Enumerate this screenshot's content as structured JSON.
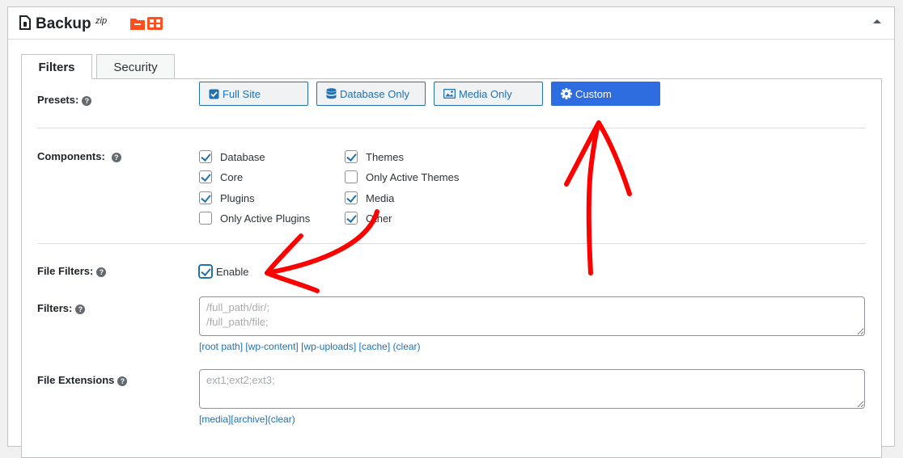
{
  "panel": {
    "title": "Backup",
    "title_sup": "zip",
    "icons": [
      "document-icon",
      "folder-icon",
      "grid-icon"
    ]
  },
  "tabs": [
    {
      "label": "Filters",
      "active": true
    },
    {
      "label": "Security",
      "active": false
    }
  ],
  "presets": {
    "label": "Presets:",
    "buttons": [
      {
        "label": "Full Site",
        "icon": "checkbox-icon",
        "active": false
      },
      {
        "label": "Database Only",
        "icon": "database-icon",
        "active": false
      },
      {
        "label": "Media Only",
        "icon": "image-icon",
        "active": false
      },
      {
        "label": "Custom",
        "icon": "gear-icon",
        "active": true
      }
    ]
  },
  "components": {
    "label": "Components:",
    "col1": [
      {
        "label": "Database",
        "checked": true
      },
      {
        "label": "Core",
        "checked": true
      },
      {
        "label": "Plugins",
        "checked": true
      },
      {
        "label": "Only Active Plugins",
        "checked": false
      }
    ],
    "col2": [
      {
        "label": "Themes",
        "checked": true
      },
      {
        "label": "Only Active Themes",
        "checked": false
      },
      {
        "label": "Media",
        "checked": true
      },
      {
        "label": "Other",
        "checked": true
      }
    ]
  },
  "file_filters": {
    "label": "File Filters:",
    "enable_label": "Enable",
    "enabled": true
  },
  "filters": {
    "label": "Filters:",
    "placeholder": "/full_path/dir/;\n/full_path/file;",
    "links": [
      "[root path]",
      "[wp-content]",
      "[wp-uploads]",
      "[cache]",
      "(clear)"
    ]
  },
  "file_extensions": {
    "label": "File Extensions",
    "placeholder": "ext1;ext2;ext3;",
    "links": [
      "[media]",
      "[archive]",
      "(clear)"
    ]
  },
  "colors": {
    "accent": "#2271b1",
    "active_button": "#2e6ddf",
    "annotation": "#ff0000",
    "icon_orange": "#ff4f1f"
  }
}
